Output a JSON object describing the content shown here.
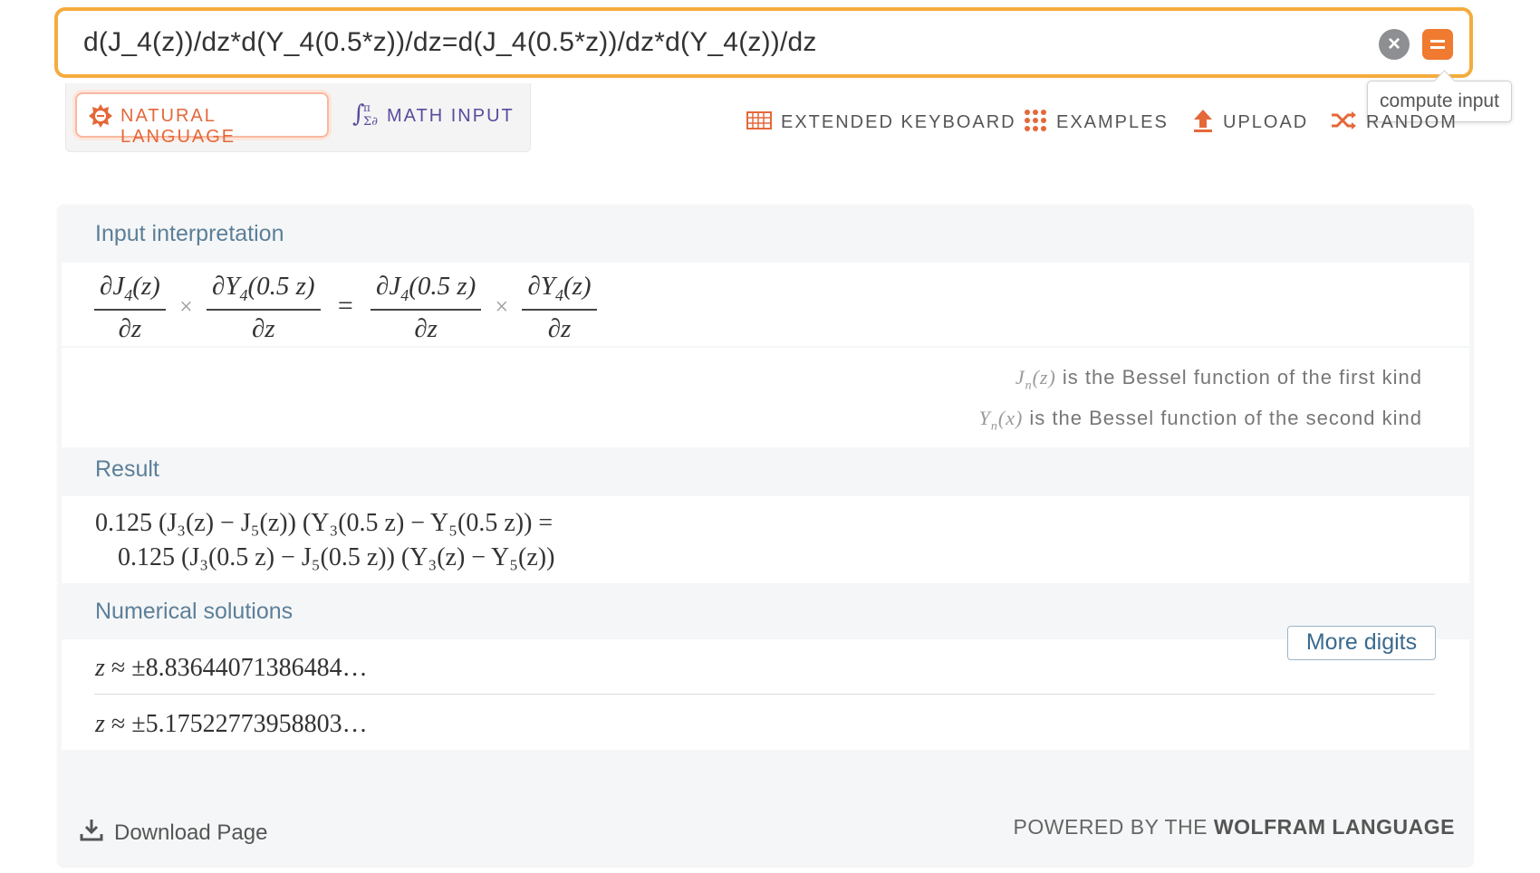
{
  "query": {
    "text": "d(J_4(z))/dz*d(Y_4(0.5*z))/dz=d(J_4(0.5*z))/dz*d(Y_4(z))/dz",
    "clear_icon": "close-icon",
    "compute_icon": "equals-icon",
    "tooltip": "compute input"
  },
  "modes": {
    "natural_language": "NATURAL LANGUAGE",
    "math_input": "MATH INPUT"
  },
  "toolbar": {
    "extended_keyboard": "EXTENDED KEYBOARD",
    "examples": "EXAMPLES",
    "upload": "UPLOAD",
    "random": "RANDOM"
  },
  "pods": {
    "input_interpretation": {
      "title": "Input interpretation",
      "notes": [
        "is the Bessel function of the first kind",
        "is the Bessel function of the second kind"
      ]
    },
    "result": {
      "title": "Result",
      "line1": "0.125 (J₃(z) − J₅(z)) (Y₃(0.5 z) − Y₅(0.5 z)) =",
      "line2": "0.125 (J₃(0.5 z) − J₅(0.5 z)) (Y₃(z) − Y₅(z))"
    },
    "numerical_solutions": {
      "title": "Numerical solutions",
      "more_digits": "More digits",
      "solutions": [
        "±8.83644071386484…",
        "±5.17522773958803…"
      ]
    }
  },
  "footer": {
    "download": "Download Page",
    "powered_prefix": "POWERED BY THE ",
    "powered_brand": "WOLFRAM LANGUAGE"
  },
  "colors": {
    "accent_orange": "#ef7a30",
    "query_border": "#f4ac3e",
    "pod_title": "#5b7f99",
    "math_input_purple": "#5b4a9e"
  }
}
